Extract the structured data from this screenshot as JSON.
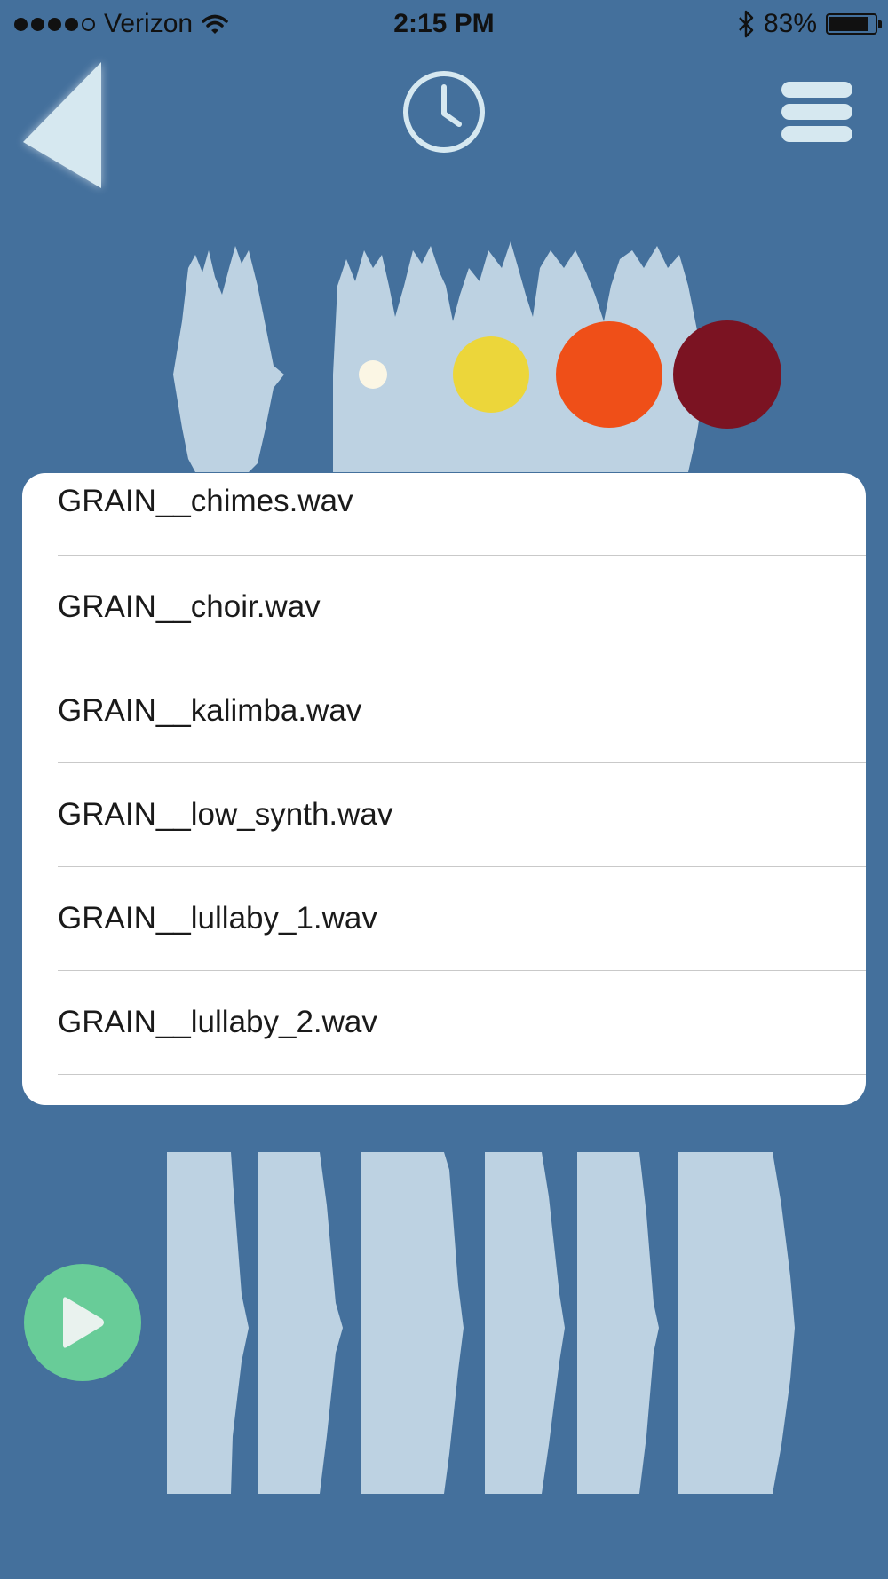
{
  "status_bar": {
    "carrier": "Verizon",
    "time": "2:15 PM",
    "battery_level": "83%"
  },
  "nav": {
    "back_icon": "back-triangle-icon",
    "history_icon": "clock-icon",
    "menu_icon": "hamburger-menu-icon"
  },
  "grain_markers": {
    "colors": [
      "#fbf6e4",
      "#ecd63a",
      "#ef4f18",
      "#7b1322"
    ]
  },
  "file_list": {
    "items": [
      "GRAIN__chimes.wav",
      "GRAIN__choir.wav",
      "GRAIN__kalimba.wav",
      "GRAIN__low_synth.wav",
      "GRAIN__lullaby_1.wav",
      "GRAIN__lullaby_2.wav"
    ]
  },
  "player": {
    "play_icon": "play-icon"
  },
  "colors": {
    "background": "#44709c",
    "waveform": "#bdd2e2",
    "play_button": "#68cc98"
  }
}
